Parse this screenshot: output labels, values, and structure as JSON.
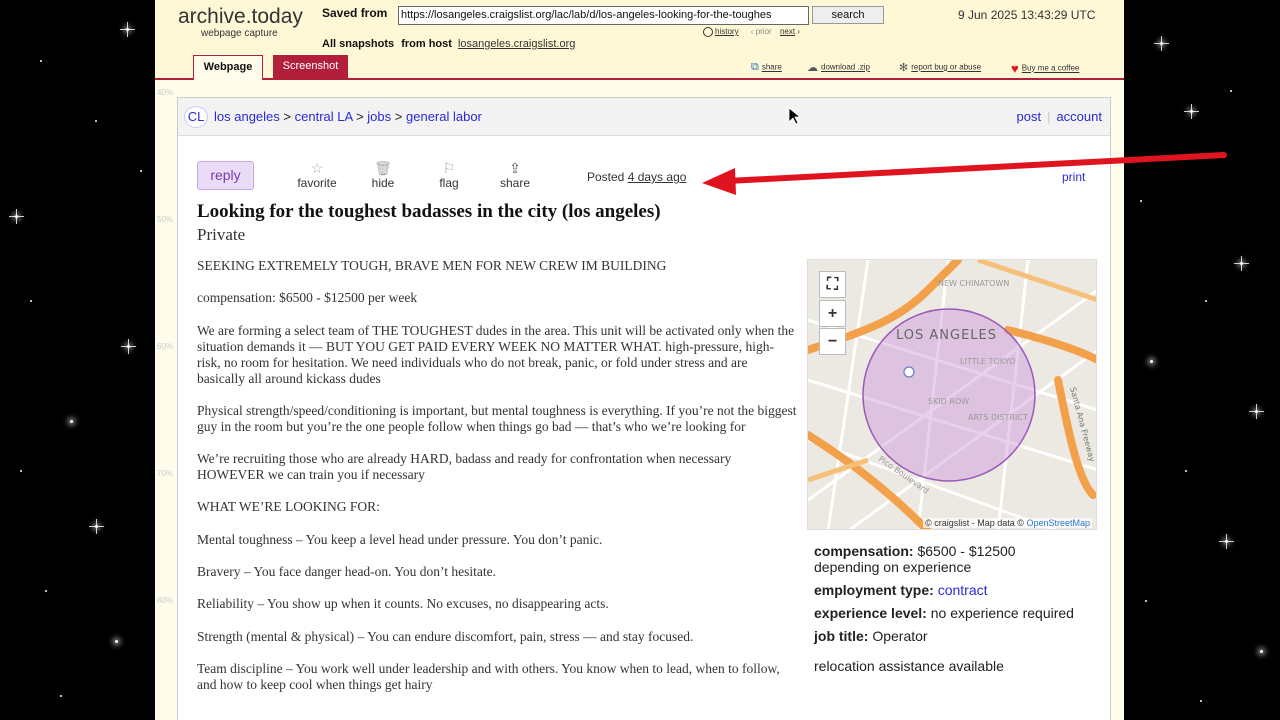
{
  "archive": {
    "logo": "archive.today",
    "subtitle": "webpage capture",
    "saved_from_label": "Saved from",
    "url": "https://losangeles.craigslist.org/lac/lab/d/los-angeles-looking-for-the-toughes",
    "search_label": "search",
    "timestamp": "9 Jun 2025 13:43:29 UTC",
    "history_label": "history",
    "prior_label": "prior",
    "next_label": "next",
    "all_snapshots_label": "All snapshots",
    "from_host_label": "from host",
    "host": "losangeles.craigslist.org",
    "tabs": {
      "webpage": "Webpage",
      "screenshot": "Screenshot"
    },
    "tools": {
      "share": "share",
      "download": "download .zip",
      "report": "report bug or abuse",
      "coffee": "Buy me a coffee"
    },
    "ruler": [
      "40%",
      "50%",
      "60%",
      "70%",
      "80%"
    ]
  },
  "craigslist": {
    "badge": "CL",
    "breadcrumbs": [
      "los angeles",
      "central LA",
      "jobs",
      "general labor"
    ],
    "post_link": "post",
    "account_link": "account",
    "reply_label": "reply",
    "actions": {
      "favorite": "favorite",
      "hide": "hide",
      "flag": "flag",
      "share": "share"
    },
    "posted_label": "Posted",
    "posted_ago": "4 days ago",
    "print_label": "print",
    "title": "Looking for the toughest badasses in the city (los angeles)",
    "subtitle": "Private",
    "body": [
      "SEEKING EXTREMELY TOUGH, BRAVE MEN FOR NEW CREW IM BUILDING",
      "compensation: $6500 - $12500 per week",
      "We are forming a select team of THE TOUGHEST dudes in the area. This unit will be activated only when the situation demands it — BUT YOU GET PAID EVERY WEEK NO MATTER WHAT. high-pressure, high-risk, no room for hesitation. We need individuals who do not break, panic, or fold under stress and are basically all around kickass dudes",
      "Physical strength/speed/conditioning is important, but mental toughness is everything. If you’re not the biggest guy in the room but you’re the one people follow when things go bad — that’s who we’re looking for",
      "We’re recruiting those who are already HARD, badass and ready for confrontation when necessary HOWEVER we can train you if necessary",
      "WHAT WE’RE LOOKING FOR:",
      "Mental toughness – You keep a level head under pressure. You don’t panic.",
      "Bravery – You face danger head-on. You don’t hesitate.",
      "Reliability – You show up when it counts. No excuses, no disappearing acts.",
      "Strength (mental & physical) – You can endure discomfort, pain, stress — and stay focused.",
      "Team discipline – You work well under leadership and with others. You know when to lead, when to follow, and how to keep cool when things get hairy"
    ],
    "map": {
      "city_label": "LOS ANGELES",
      "credit": "© craigslist - Map data ©",
      "credit_link": "OpenStreetMap",
      "labels": [
        "LITTLE TOKYO",
        "ARTS DISTRICT",
        "SKID ROW",
        "Santa Ana Freeway",
        "NEW CHINATOWN",
        "Pico Boulevard"
      ]
    },
    "attributes": {
      "compensation_label": "compensation:",
      "compensation_value": "$6500 - $12500",
      "compensation_note": "depending on experience",
      "employment_label": "employment type:",
      "employment_value": "contract",
      "experience_label": "experience level:",
      "experience_value": "no experience required",
      "job_title_label": "job title:",
      "job_title_value": "Operator",
      "relocation": "relocation assistance available"
    }
  },
  "colors": {
    "archive_bg": "#fff8d6",
    "archive_accent": "#b11f3b",
    "link_blue": "#2a2ad6",
    "reply_purple": "#eadcf7",
    "arrow_red": "#e0141e"
  }
}
